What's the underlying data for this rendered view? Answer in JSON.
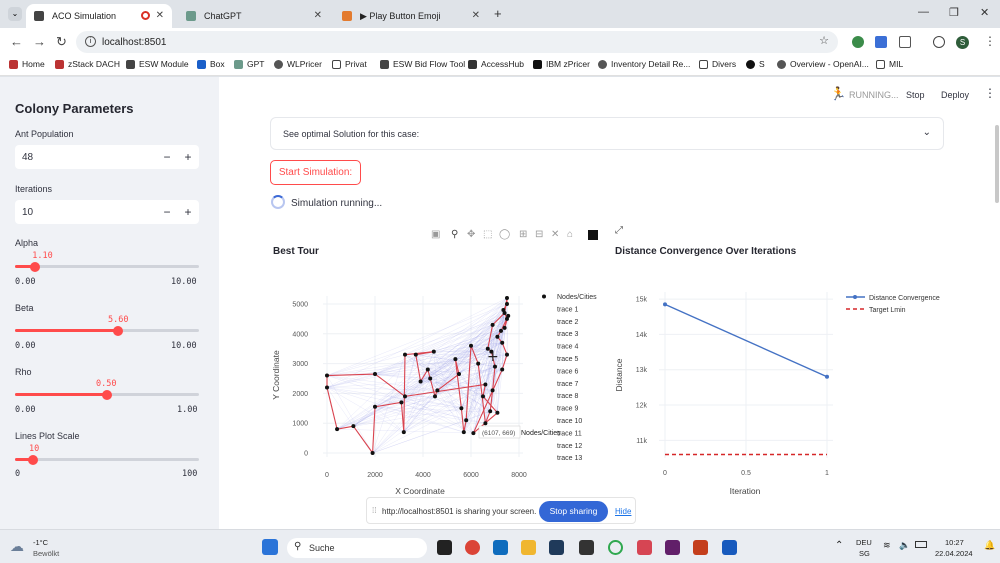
{
  "browser": {
    "tabs": [
      {
        "title": "ACO Simulation",
        "active": true
      },
      {
        "title": "ChatGPT",
        "active": false
      },
      {
        "title": "▶ Play Button Emoji",
        "active": false
      }
    ],
    "url": "localhost:8501",
    "bookmarks": [
      "Home",
      "zStack DACH",
      "ESW Module",
      "Box",
      "GPT",
      "WLPricer",
      "Privat",
      "ESW Bid Flow Tool",
      "AccessHub",
      "IBM zPricer",
      "Inventory Detail Re...",
      "Divers",
      "S",
      "Overview - OpenAI...",
      "MIL"
    ]
  },
  "sidebar": {
    "title": "Colony Parameters",
    "ant_population": {
      "label": "Ant Population",
      "value": "48"
    },
    "iterations": {
      "label": "Iterations",
      "value": "10"
    },
    "alpha": {
      "label": "Alpha",
      "value": "1.10",
      "min": "0.00",
      "max": "10.00",
      "fraction": 0.11
    },
    "beta": {
      "label": "Beta",
      "value": "5.60",
      "min": "0.00",
      "max": "10.00",
      "fraction": 0.56
    },
    "rho": {
      "label": "Rho",
      "value": "0.50",
      "min": "0.00",
      "max": "1.00",
      "fraction": 0.5
    },
    "lines_scale": {
      "label": "Lines Plot Scale",
      "value": "10",
      "min": "0",
      "max": "100",
      "fraction": 0.1
    }
  },
  "header": {
    "status": "RUNNING...",
    "stop": "Stop",
    "deploy": "Deploy"
  },
  "main": {
    "expander": "See optimal Solution for this case:",
    "start_button": "Start Simulation:",
    "running_text": "Simulation running..."
  },
  "tour_chart": {
    "title": "Best Tour",
    "xlabel": "X Coordinate",
    "ylabel": "Y Coordinate",
    "xticks": [
      "0",
      "2000",
      "4000",
      "6000",
      "8000"
    ],
    "yticks": [
      "0",
      "1000",
      "2000",
      "3000",
      "4000",
      "5000"
    ],
    "legend": [
      "Nodes/Cities",
      "trace 1",
      "trace 2",
      "trace 3",
      "trace 4",
      "trace 5",
      "trace 6",
      "trace 7",
      "trace 8",
      "trace 9",
      "trace 10",
      "trace 11",
      "trace 12",
      "trace 13"
    ],
    "hover_coords": "(6107, 669)",
    "hover_name": "Nodes/Cities"
  },
  "conv_chart": {
    "title": "Distance Convergence Over Iterations",
    "xlabel": "Iteration",
    "ylabel": "Distance",
    "xticks": [
      "0",
      "0.5",
      "1"
    ],
    "yticks": [
      "11k",
      "12k",
      "13k",
      "14k",
      "15k"
    ],
    "legend": [
      "Distance Convergence",
      "Target Lmin"
    ]
  },
  "chart_data": [
    {
      "type": "scatter",
      "title": "Best Tour",
      "xlabel": "X Coordinate",
      "ylabel": "Y Coordinate",
      "xlim": [
        0,
        8000
      ],
      "ylim": [
        0,
        5000
      ],
      "series": [
        {
          "name": "Nodes/Cities",
          "x": [
            0,
            0,
            420,
            1100,
            1900,
            2000,
            3100,
            3200,
            3250,
            4450,
            3700,
            3900,
            4200,
            4300,
            4500,
            4600,
            5500,
            5350,
            5600,
            5700,
            5800,
            6000,
            6300,
            6600,
            6800,
            6900,
            7000,
            6850,
            6700,
            6900,
            7400,
            7500,
            7500,
            7350,
            7500,
            7400,
            7550,
            7250,
            7100,
            7300,
            7500,
            7300,
            6100,
            7100,
            6500,
            6600,
            3250,
            2000
          ],
          "y": [
            2600,
            2200,
            800,
            900,
            0,
            1550,
            1700,
            700,
            3300,
            3400,
            3300,
            2400,
            2800,
            2500,
            1900,
            2100,
            2650,
            3150,
            1500,
            700,
            1100,
            3600,
            3000,
            1000,
            1400,
            2100,
            2900,
            3400,
            3500,
            4300,
            4700,
            5200,
            5000,
            4800,
            4500,
            4200,
            4600,
            4100,
            3900,
            3700,
            3300,
            2800,
            669,
            1350,
            1900,
            2300,
            1900,
            2650
          ]
        }
      ]
    },
    {
      "type": "line",
      "title": "Distance Convergence Over Iterations",
      "xlabel": "Iteration",
      "ylabel": "Distance",
      "ylim": [
        10500,
        15200
      ],
      "series": [
        {
          "name": "Distance Convergence",
          "x": [
            0,
            1
          ],
          "y": [
            14850,
            12800
          ]
        },
        {
          "name": "Target Lmin",
          "x": [
            0,
            1
          ],
          "y": [
            10600,
            10600
          ]
        }
      ]
    }
  ],
  "share_bar": {
    "text": "http://localhost:8501 is sharing your screen.",
    "stop": "Stop sharing",
    "hide": "Hide"
  },
  "taskbar": {
    "weather_temp": "-1°C",
    "weather_desc": "Bewölkt",
    "search": "Suche",
    "lang": "DEU",
    "lang2": "SG",
    "time": "10:27",
    "date": "22.04.2024"
  }
}
